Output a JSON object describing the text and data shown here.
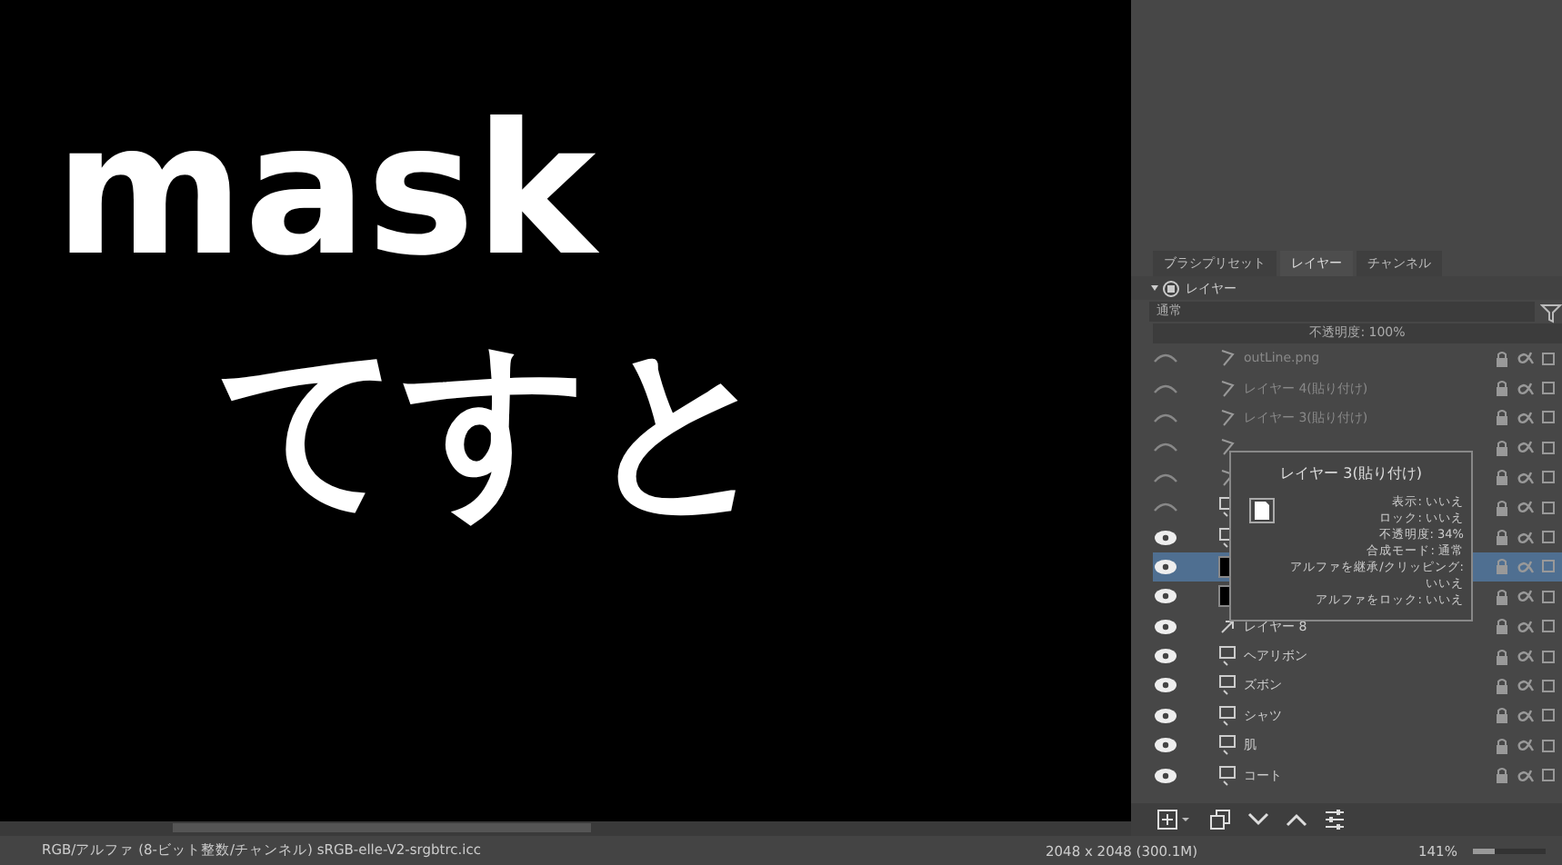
{
  "canvas": {
    "lines": [
      "mask",
      "てすと"
    ]
  },
  "docker": {
    "tabs": [
      {
        "label": "ブラシプリセット",
        "selected": false
      },
      {
        "label": "レイヤー",
        "selected": true
      },
      {
        "label": "チャンネル",
        "selected": false
      }
    ],
    "header": "レイヤー",
    "blend_mode": "通常",
    "opacity": "不透明度: 100%",
    "opacity_level": {
      "level": 1
    },
    "layers": [
      {
        "kind": "filter",
        "name": "outLine.png",
        "visible": false,
        "selected": false
      },
      {
        "kind": "filter",
        "name": "レイヤー 4(貼り付け)",
        "visible": false,
        "selected": false
      },
      {
        "kind": "filter",
        "name": "レイヤー 3(貼り付け)",
        "visible": false,
        "selected": false
      },
      {
        "kind": "filter",
        "visible": false,
        "selected": false
      },
      {
        "kind": "filter",
        "visible": false,
        "selected": false
      },
      {
        "kind": "group",
        "visible": false,
        "selected": false
      },
      {
        "kind": "group",
        "visible": true,
        "selected": false
      },
      {
        "kind": "paint",
        "visible": true,
        "selected": true
      },
      {
        "kind": "paint",
        "visible": true,
        "selected": false
      },
      {
        "kind": "clone",
        "name": "レイヤー 8",
        "visible": true,
        "selected": false
      },
      {
        "kind": "group",
        "name": "ヘアリボン",
        "visible": true,
        "selected": false
      },
      {
        "kind": "group",
        "name": "ズボン",
        "visible": true,
        "selected": false
      },
      {
        "kind": "group",
        "name": "シャツ",
        "visible": true,
        "selected": false
      },
      {
        "kind": "group",
        "name": "肌",
        "visible": true,
        "selected": false
      },
      {
        "kind": "group",
        "name": "コート",
        "visible": true,
        "selected": false
      }
    ],
    "tooltip": {
      "title": "レイヤー 3(貼り付け)",
      "lines": [
        "表示: いいえ",
        "ロック: いいえ",
        "不透明度: 34%",
        "合成モード: 通常",
        "アルファを継承/クリッピング: いいえ",
        "アルファをロック: いいえ"
      ]
    }
  },
  "status_bar": {
    "color_space": "RGB/アルファ (8-ビット整数/チャンネル)  sRGB-elle-V2-srgbtrc.icc",
    "size": "2048 x 2048 (300.1M)",
    "zoom": "141%",
    "zoom_slider": {
      "level": 0.3
    }
  }
}
